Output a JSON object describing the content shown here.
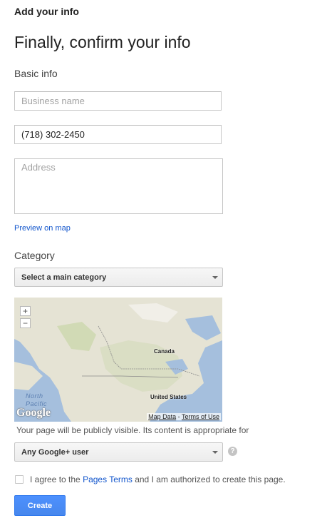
{
  "header": {
    "title": "Add your info"
  },
  "main": {
    "heading": "Finally, confirm your info",
    "basic_info_label": "Basic info",
    "business_name": {
      "placeholder": "Business name",
      "value": ""
    },
    "phone": {
      "placeholder": "",
      "value": "(718) 302-2450"
    },
    "address": {
      "placeholder": "Address",
      "value": ""
    },
    "preview_link": "Preview on map",
    "category_label": "Category",
    "category_select": {
      "selected": "Select a main category"
    },
    "map": {
      "zoom_in": "+",
      "zoom_out": "−",
      "labels": {
        "canada": "Canada",
        "us": "United States",
        "ocean_line1": "North",
        "ocean_line2": "Pacific"
      },
      "logo": "Google",
      "map_data": "Map Data",
      "separator": " - ",
      "terms_of_use": "Terms of Use"
    },
    "visibility_text": "Your page will be publicly visible. Its content is appropriate for",
    "audience_select": {
      "selected": "Any Google+ user"
    },
    "help_icon": "?",
    "agree": {
      "prefix": "I agree to the ",
      "link": "Pages Terms",
      "suffix": " and I am authorized to create this page."
    },
    "create_button": "Create"
  },
  "colors": {
    "link": "#1155cc",
    "primary_button": "#4d90fe",
    "water": "#a5bfdd",
    "land": "#e8e5da"
  }
}
